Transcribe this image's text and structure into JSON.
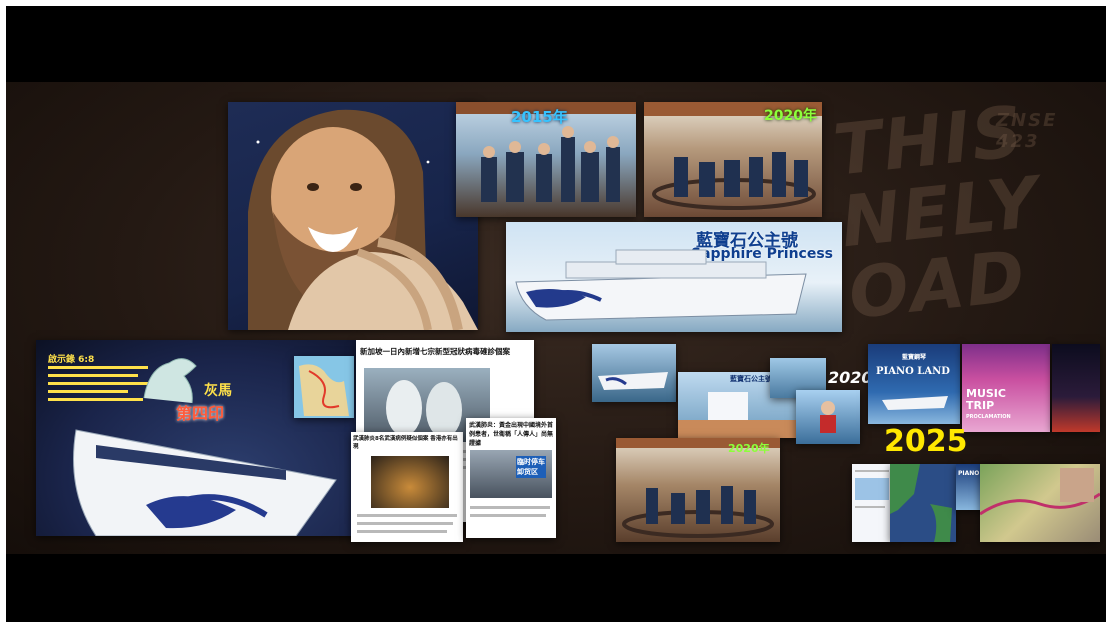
{
  "collage": {
    "labels": {
      "year_2015": "2015年",
      "year_2020_top": "2020年",
      "ship_name_cn": "藍寶石公主號",
      "ship_name_en": "Sapphire Princess",
      "news_headline": "新加坡一日內新增七宗新型冠狀病毒確診個案",
      "news_headline_2": "武漢肺炎：黃金出現中國境外首例患者，世衛稱「人傳人」尚無證據",
      "news_caption": "武漢肺炎8名武漢病例疑似個案 香港亦有出現",
      "sign_text": "臨时停车\n卸货区",
      "seal_text": "第四印",
      "horse_label": "灰馬",
      "verse_label": "啟示錄 6:8",
      "ship_label_small": "藍寶石公主號",
      "year_2020_mid": "2020年",
      "year_2020_right": "2020",
      "year_2025": "2025",
      "piano_brand": "藍寶鋼琴",
      "piano_land": "PIANO LAND",
      "piano_land_small": "PIANO LAND",
      "music_trip": "MUSIC\nTRIP",
      "proclamation": "PROCLAMATION"
    },
    "background_text": "THIS NELY OAD",
    "background_code": "ZNSE 423"
  }
}
